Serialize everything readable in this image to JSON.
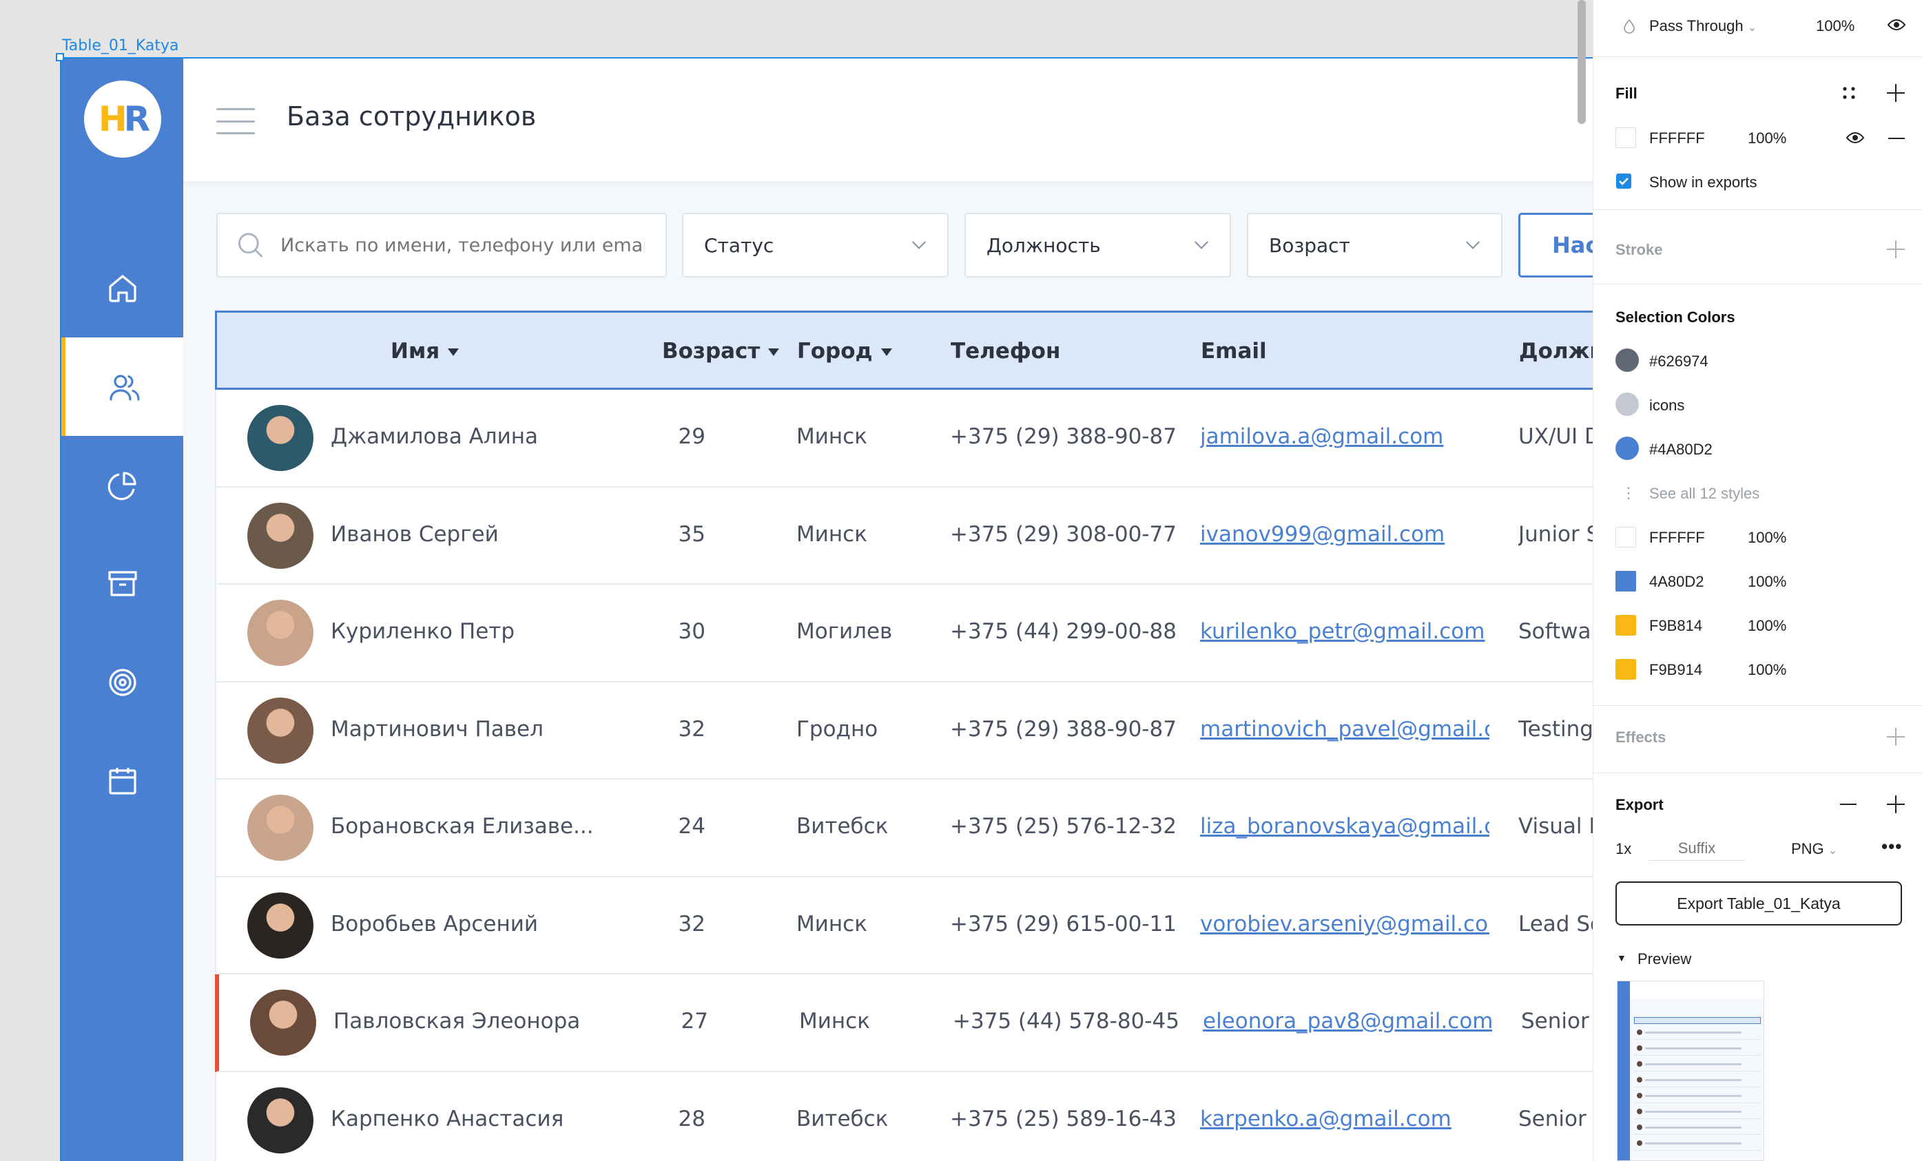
{
  "canvas": {
    "frame_label": "Table_01_Katya"
  },
  "app": {
    "logo_h": "H",
    "logo_r": "R",
    "title": "База сотрудников",
    "nav": [
      "home-icon",
      "users-icon",
      "pie-chart-icon",
      "archive-icon",
      "target-icon",
      "calendar-icon"
    ],
    "active_nav": "users-icon"
  },
  "filters": {
    "search_placeholder": "Искать по имени, телефону или email",
    "status": "Статус",
    "position": "Должность",
    "age": "Возраст",
    "settings_button": "Настройки"
  },
  "table": {
    "columns": {
      "name": "Имя",
      "age": "Возраст",
      "city": "Город",
      "phone": "Телефон",
      "email": "Email",
      "position": "Должность"
    },
    "rows": [
      {
        "name": "Джамилова Алина",
        "age": "29",
        "city": "Минск",
        "phone": "+375 (29) 388-90-87",
        "email": "jamilova.a@gmail.com",
        "position": "UX/UI Designer"
      },
      {
        "name": "Иванов Сергей",
        "age": "35",
        "city": "Минск",
        "phone": "+375 (29) 308-00-77",
        "email": "ivanov999@gmail.com",
        "position": "Junior Software Engineer"
      },
      {
        "name": "Куриленко Петр",
        "age": "30",
        "city": "Могилев",
        "phone": "+375 (44) 299-00-88",
        "email": "kurilenko_petr@gmail.com",
        "position": "Software Engineer"
      },
      {
        "name": "Мартинович Павел",
        "age": "32",
        "city": "Гродно",
        "phone": "+375 (29) 388-90-87",
        "email": "martinovich_pavel@gmail.c...",
        "position": "Testing Engineer"
      },
      {
        "name": "Борановская Елизаве...",
        "age": "24",
        "city": "Витебск",
        "phone": "+375 (25) 576-12-32",
        "email": "liza_boranovskaya@gmail.c...",
        "position": "Visual Designer"
      },
      {
        "name": "Воробьев Арсений",
        "age": "32",
        "city": "Минск",
        "phone": "+375 (29) 615-00-11",
        "email": "vorobiev.arseniy@gmail.com",
        "position": "Lead Software Engineer"
      },
      {
        "name": "Павловская Элеонора",
        "age": "27",
        "city": "Минск",
        "phone": "+375 (44) 578-80-45",
        "email": "eleonora_pav8@gmail.com",
        "position": "Senior Testing Engineer"
      },
      {
        "name": "Карпенко Анастасия",
        "age": "28",
        "city": "Витебск",
        "phone": "+375 (25) 589-16-43",
        "email": "karpenko.a@gmail.com",
        "position": "Senior UX/UI Designer"
      }
    ],
    "avatar_colors": [
      "#2d5a6b",
      "#6b5a4a",
      "#c9a48a",
      "#7a5a48",
      "#c9a58e",
      "#2b2522",
      "#6a4a3a",
      "#2a2a2a"
    ]
  },
  "panel": {
    "layer": {
      "blend_mode": "Pass Through",
      "opacity": "100%"
    },
    "fill": {
      "title": "Fill",
      "hex": "FFFFFF",
      "opacity": "100%",
      "show_in_exports": "Show in exports"
    },
    "stroke": {
      "title": "Stroke"
    },
    "selection_colors": {
      "title": "Selection Colors",
      "styles": [
        {
          "label": "#626974",
          "color": "#626974"
        },
        {
          "label": "icons",
          "color": "#c4c9d1"
        },
        {
          "label": "#4A80D2",
          "color": "#4a80d2"
        }
      ],
      "see_all": "See all 12 styles",
      "colors": [
        {
          "hex": "FFFFFF",
          "opacity": "100%",
          "color": "#ffffff"
        },
        {
          "hex": "4A80D2",
          "opacity": "100%",
          "color": "#4a80d2"
        },
        {
          "hex": "F9B814",
          "opacity": "100%",
          "color": "#f9b814"
        },
        {
          "hex": "F9B914",
          "opacity": "100%",
          "color": "#f9b914"
        }
      ]
    },
    "effects": {
      "title": "Effects"
    },
    "export": {
      "title": "Export",
      "scale": "1x",
      "suffix_placeholder": "Suffix",
      "format": "PNG",
      "button": "Export Table_01_Katya"
    },
    "preview": {
      "title": "Preview"
    }
  }
}
